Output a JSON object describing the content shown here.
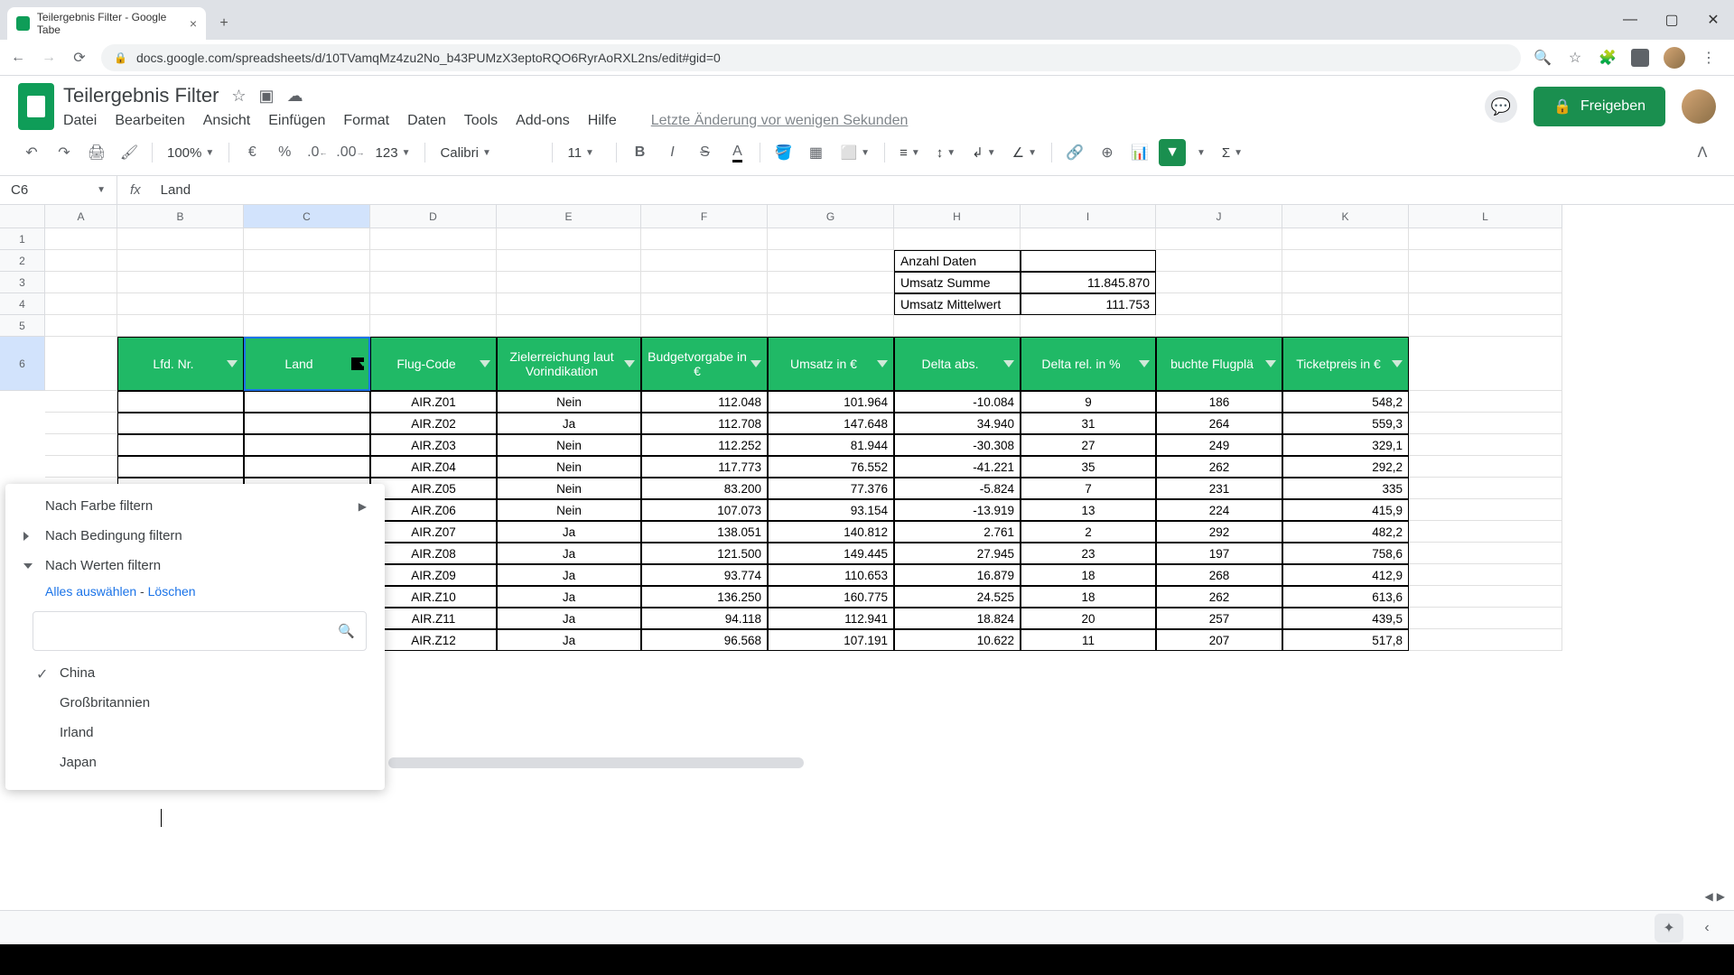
{
  "browser": {
    "tab_title": "Teilergebnis Filter - Google Tabe",
    "url": "docs.google.com/spreadsheets/d/10TVamqMz4zu2No_b43PUMzX3eptoRQO6RyrAoRXL2ns/edit#gid=0"
  },
  "doc": {
    "title": "Teilergebnis Filter",
    "last_change": "Letzte Änderung vor wenigen Sekunden",
    "share_label": "Freigeben"
  },
  "menu": [
    "Datei",
    "Bearbeiten",
    "Ansicht",
    "Einfügen",
    "Format",
    "Daten",
    "Tools",
    "Add-ons",
    "Hilfe"
  ],
  "toolbar": {
    "zoom": "100%",
    "currency": "€",
    "percent": "%",
    "dec_dec": ".0",
    "inc_dec": ".00",
    "numfmt": "123",
    "font": "Calibri",
    "size": "11"
  },
  "namebox": "C6",
  "formula": "Land",
  "columns": [
    "A",
    "B",
    "C",
    "D",
    "E",
    "F",
    "G",
    "H",
    "I",
    "J",
    "K",
    "L"
  ],
  "rows_visible": [
    "1",
    "2",
    "3",
    "4",
    "5",
    "6"
  ],
  "summary": {
    "labels": [
      "Anzahl Daten",
      "Umsatz Summe",
      "Umsatz Mittelwert"
    ],
    "values": [
      "",
      "11.845.870",
      "111.753"
    ]
  },
  "headers": [
    "Lfd. Nr.",
    "Land",
    "Flug-Code",
    "Zielerreichung laut Vorindikation",
    "Budgetvorgabe in €",
    "Umsatz in €",
    "Delta abs.",
    "Delta rel. in %",
    "buchte Flugplä",
    "Ticketpreis in €"
  ],
  "data_rows": [
    {
      "code": "AIR.Z01",
      "ziel": "Nein",
      "budget": "112.048",
      "umsatz": "101.964",
      "dabs": "-10.084",
      "drel": "9",
      "flug": "186",
      "preis": "548,2"
    },
    {
      "code": "AIR.Z02",
      "ziel": "Ja",
      "budget": "112.708",
      "umsatz": "147.648",
      "dabs": "34.940",
      "drel": "31",
      "flug": "264",
      "preis": "559,3"
    },
    {
      "code": "AIR.Z03",
      "ziel": "Nein",
      "budget": "112.252",
      "umsatz": "81.944",
      "dabs": "-30.308",
      "drel": "27",
      "flug": "249",
      "preis": "329,1"
    },
    {
      "code": "AIR.Z04",
      "ziel": "Nein",
      "budget": "117.773",
      "umsatz": "76.552",
      "dabs": "-41.221",
      "drel": "35",
      "flug": "262",
      "preis": "292,2"
    },
    {
      "code": "AIR.Z05",
      "ziel": "Nein",
      "budget": "83.200",
      "umsatz": "77.376",
      "dabs": "-5.824",
      "drel": "7",
      "flug": "231",
      "preis": "335"
    },
    {
      "code": "AIR.Z06",
      "ziel": "Nein",
      "budget": "107.073",
      "umsatz": "93.154",
      "dabs": "-13.919",
      "drel": "13",
      "flug": "224",
      "preis": "415,9"
    },
    {
      "code": "AIR.Z07",
      "ziel": "Ja",
      "budget": "138.051",
      "umsatz": "140.812",
      "dabs": "2.761",
      "drel": "2",
      "flug": "292",
      "preis": "482,2"
    },
    {
      "code": "AIR.Z08",
      "ziel": "Ja",
      "budget": "121.500",
      "umsatz": "149.445",
      "dabs": "27.945",
      "drel": "23",
      "flug": "197",
      "preis": "758,6"
    },
    {
      "code": "AIR.Z09",
      "ziel": "Ja",
      "budget": "93.774",
      "umsatz": "110.653",
      "dabs": "16.879",
      "drel": "18",
      "flug": "268",
      "preis": "412,9"
    },
    {
      "code": "AIR.Z10",
      "ziel": "Ja",
      "budget": "136.250",
      "umsatz": "160.775",
      "dabs": "24.525",
      "drel": "18",
      "flug": "262",
      "preis": "613,6"
    },
    {
      "code": "AIR.Z11",
      "ziel": "Ja",
      "budget": "94.118",
      "umsatz": "112.941",
      "dabs": "18.824",
      "drel": "20",
      "flug": "257",
      "preis": "439,5"
    },
    {
      "code": "AIR.Z12",
      "ziel": "Ja",
      "budget": "96.568",
      "umsatz": "107.191",
      "dabs": "10.622",
      "drel": "11",
      "flug": "207",
      "preis": "517,8"
    }
  ],
  "filter_popup": {
    "by_color": "Nach Farbe filtern",
    "by_condition": "Nach Bedingung filtern",
    "by_values": "Nach Werten filtern",
    "select_all": "Alles auswählen",
    "separator": " - ",
    "clear": "Löschen",
    "values": [
      {
        "label": "China",
        "checked": true
      },
      {
        "label": "Großbritannien",
        "checked": false
      },
      {
        "label": "Irland",
        "checked": false
      },
      {
        "label": "Japan",
        "checked": false
      }
    ]
  }
}
